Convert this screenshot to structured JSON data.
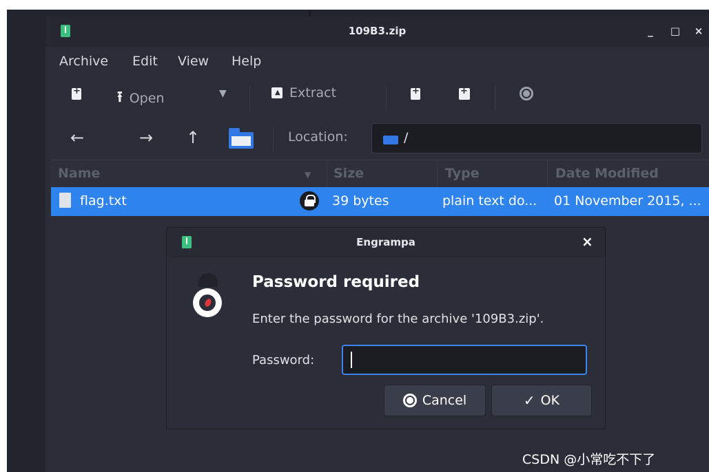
{
  "window": {
    "title": "109B3.zip",
    "minimize": "_",
    "maximize": "□",
    "close": "×"
  },
  "menu": [
    "Archive",
    "Edit",
    "View",
    "Help"
  ],
  "toolbar": {
    "open_label": "Open",
    "extract_label": "Extract"
  },
  "navigation": {
    "location_label": "Location:",
    "location_path": "/"
  },
  "file_list": {
    "columns": [
      "Name",
      "Size",
      "Type",
      "Date Modified"
    ],
    "rows": [
      {
        "name": "flag.txt",
        "size": "39 bytes",
        "type": "plain text do...",
        "modified": "01 November 2015, ..."
      }
    ]
  },
  "dialog": {
    "title": "Engrampa",
    "close": "×",
    "heading": "Password required",
    "message": "Enter the password for the archive '109B3.zip'.",
    "password_label": "Password:",
    "password_value": "",
    "cancel_label": "Cancel",
    "ok_label": "OK"
  },
  "watermark": "CSDN @小常吃不下了",
  "colors": {
    "accent": "#2f83ec",
    "focus_border": "#3b84f2",
    "app_icon": "#3fbf7f",
    "window_bg": "#2a2d37"
  }
}
